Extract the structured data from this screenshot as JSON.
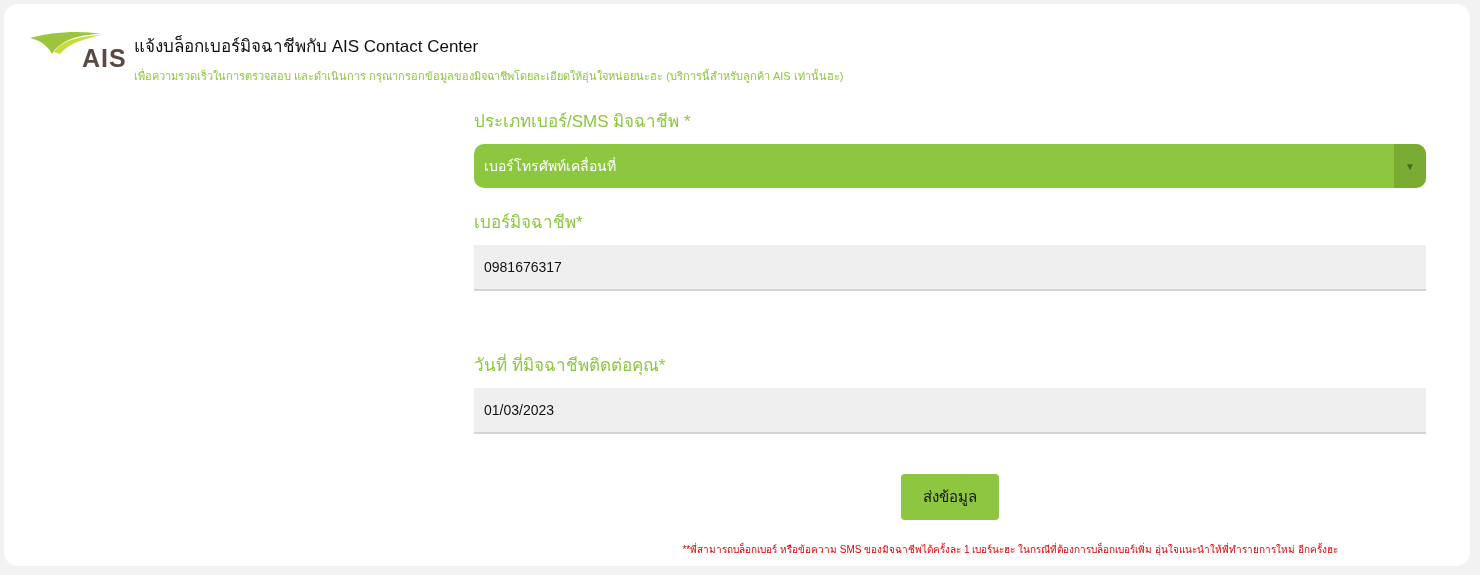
{
  "header": {
    "logo_text": "AIS",
    "title": "แจ้งบล็อกเบอร์มิจฉาชีพกับ AIS Contact Center",
    "subtitle": "เพื่อความรวดเร็วในการตรวจสอบ และดำเนินการ กรุณากรอกข้อมูลของมิจฉาชีพโดยละเอียดให้อุ่นใจหน่อยนะฮะ (บริการนี้สำหรับลูกค้า AIS เท่านั้นฮะ)"
  },
  "fields": [
    {
      "kind": "select",
      "label": "ประเภทเบอร์/SMS มิจฉาชีพ *",
      "value": "เบอร์โทรศัพท์เคลื่อนที่",
      "caret": "▼"
    },
    {
      "kind": "text",
      "label": "เบอร์มิจฉาชีพ*",
      "value": "0981676317"
    },
    {
      "kind": "text",
      "label": "วันที่ ที่มิจฉาชีพติดต่อคุณ*",
      "value": "01/03/2023"
    }
  ],
  "submit": "ส่งข้อมูล",
  "note": "**พี่สามารถบล็อกเบอร์ หรือข้อความ SMS ของมิจฉาชีพได้ครั้งละ 1 เบอร์นะฮะ ในกรณีที่ต้องการบล็อกเบอร์เพิ่ม อุ่นใจแนะนำให้พี่ทำรายการใหม่ อีกครั้งฮะ"
}
